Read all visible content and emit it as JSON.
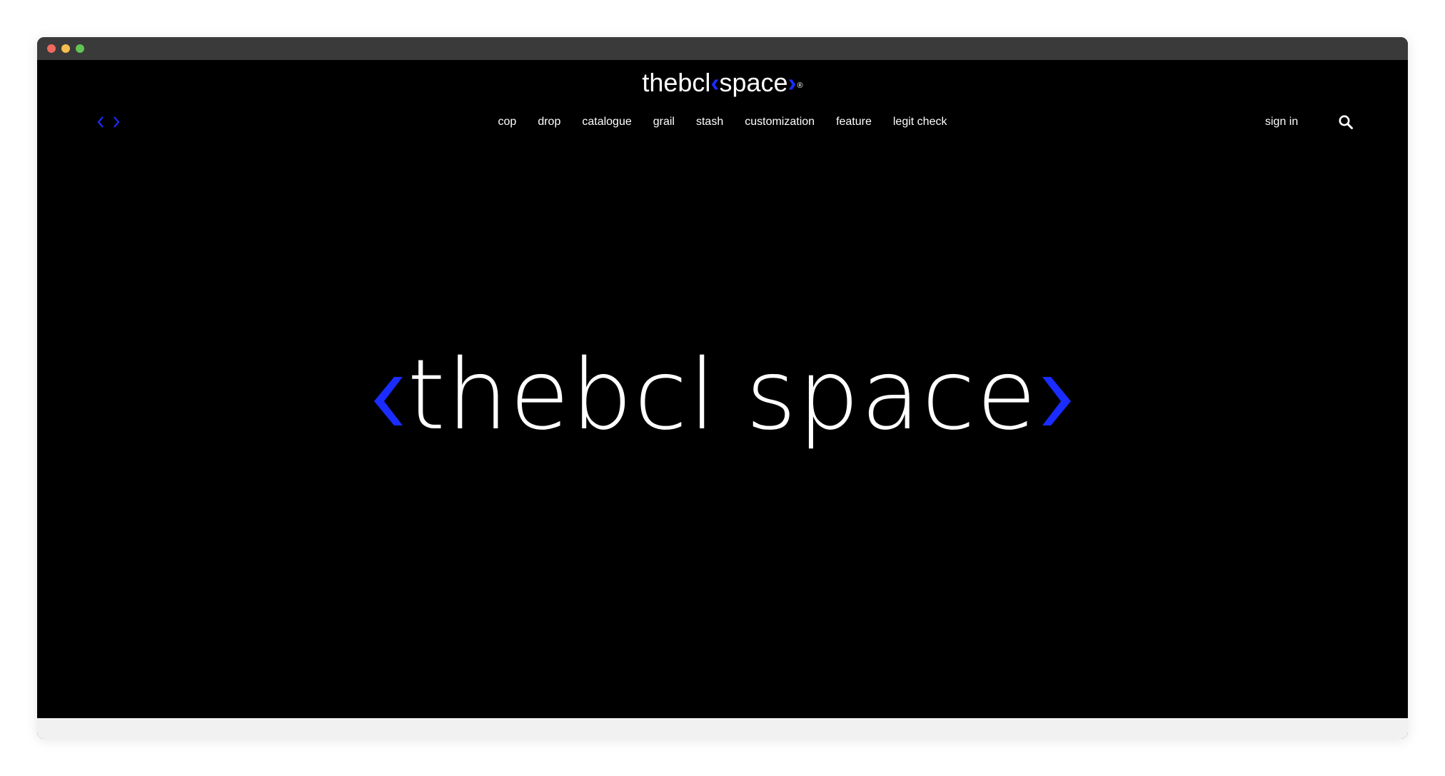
{
  "window": {
    "traffic_lights": [
      "#ee6a5f",
      "#f5bd4f",
      "#61c454"
    ]
  },
  "brand": {
    "left": "thebcl",
    "right": "space",
    "registered": "®",
    "accent_color": "#1a2cff"
  },
  "nav": {
    "items": [
      "cop",
      "drop",
      "catalogue",
      "grail",
      "stash",
      "customization",
      "feature",
      "legit check"
    ],
    "sign_in": "sign in",
    "search_icon": "search-icon",
    "prev_icon": "chevron-left-icon",
    "next_icon": "chevron-right-icon"
  },
  "hero": {
    "word1": "thebcl",
    "word2": "space"
  }
}
